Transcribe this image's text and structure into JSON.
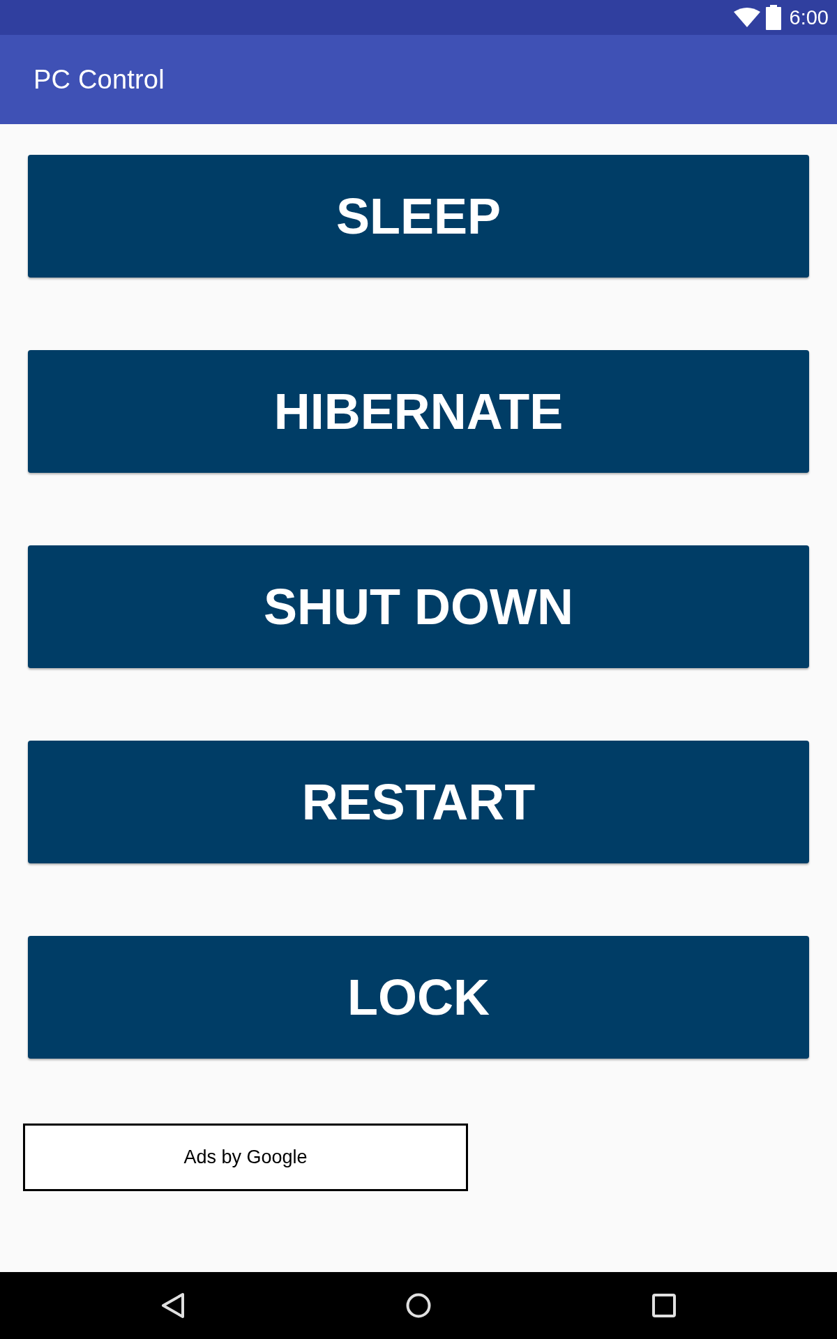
{
  "status_bar": {
    "time": "6:00"
  },
  "app_bar": {
    "title": "PC Control"
  },
  "buttons": [
    {
      "label": "SLEEP"
    },
    {
      "label": "HIBERNATE"
    },
    {
      "label": "SHUT DOWN"
    },
    {
      "label": "RESTART"
    },
    {
      "label": "LOCK"
    }
  ],
  "ad_banner": {
    "label": "Ads by Google"
  }
}
